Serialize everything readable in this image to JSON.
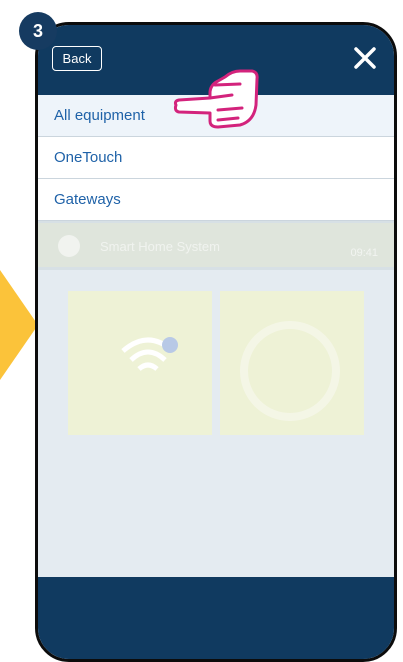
{
  "step": "3",
  "header": {
    "back_label": "Back"
  },
  "menu": {
    "items": [
      {
        "label": "All equipment"
      },
      {
        "label": "OneTouch"
      },
      {
        "label": "Gateways"
      }
    ]
  },
  "background": {
    "system_name": "Smart Home System",
    "time": "09:41"
  },
  "colors": {
    "topbar": "#103a60",
    "link": "#1f62a8",
    "arrow": "#fbc33a",
    "hand": "#d3237c"
  },
  "icons": [
    "close-icon",
    "hand-pointer-icon",
    "wifi-icon",
    "gear-icon"
  ]
}
